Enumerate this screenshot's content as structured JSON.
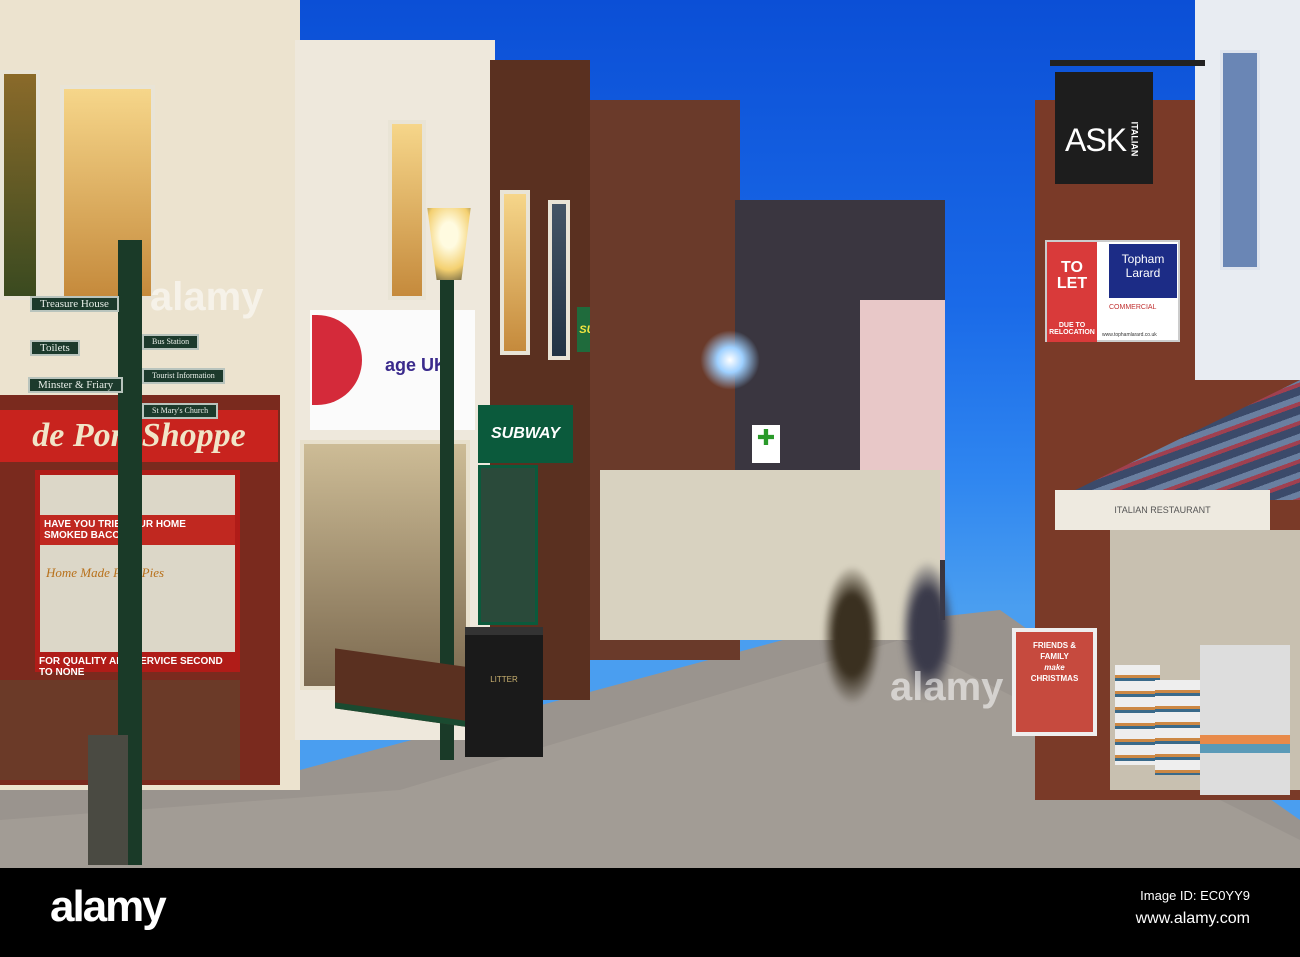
{
  "watermark": {
    "logo": "alamy",
    "image_id": "Image ID: EC0YY9",
    "url": "www.alamy.com"
  },
  "shops": {
    "porte_shoppe": {
      "name": "de Port Shoppe",
      "poster_heading": "HAVE YOU TRIED OUR HOME SMOKED BACON?",
      "poster_note": "Home Made Pork Pies",
      "poster_footer": "FOR QUALITY AND SERVICE SECOND TO NONE"
    },
    "age_uk": {
      "name": "age UK"
    },
    "subway": {
      "name": "SUBWAY",
      "hanging": "SUBWAY"
    },
    "ask": {
      "name": "ASK",
      "sub": "ITALIAN"
    },
    "italian_awning": "ITALIAN RESTAURANT",
    "litter_bin": "LITTER",
    "a_board": {
      "line1": "FRIENDS &",
      "line2": "FAMILY",
      "line3": "make",
      "line4": "CHRISTMAS"
    }
  },
  "to_let_board": {
    "to_let": "TO LET",
    "reason": "DUE TO RELOCATION",
    "agent": "Topham Larard",
    "type": "COMMERCIAL",
    "website": "www.tophamlarard.co.uk"
  },
  "signpost": {
    "left": [
      "Treasure House",
      "Toilets",
      "Minster & Friary"
    ],
    "right": [
      "Bus Station",
      "Tourist Information",
      "St Mary's Church"
    ]
  },
  "colors": {
    "sky": "#1a6ae8",
    "shop_red": "#c8231e",
    "subway_green": "#0b5a3c",
    "ask_black": "#1d1d1d"
  }
}
